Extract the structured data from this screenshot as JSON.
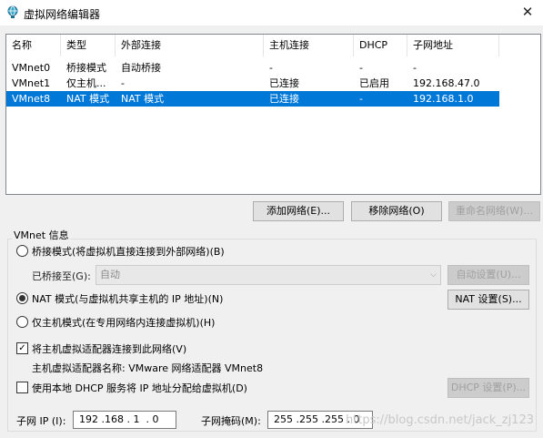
{
  "window": {
    "title": "虚拟网络编辑器",
    "close_label": "✕"
  },
  "table": {
    "headers": [
      "名称",
      "类型",
      "外部连接",
      "主机连接",
      "DHCP",
      "子网地址"
    ],
    "rows": [
      {
        "name": "VMnet0",
        "type": "桥接模式",
        "external": "自动桥接",
        "host": "-",
        "dhcp": "-",
        "subnet": "-"
      },
      {
        "name": "VMnet1",
        "type": "仅主机...",
        "external": "-",
        "host": "已连接",
        "dhcp": "已启用",
        "subnet": "192.168.47.0"
      },
      {
        "name": "VMnet8",
        "type": "NAT 模式",
        "external": "NAT 模式",
        "host": "已连接",
        "dhcp": "-",
        "subnet": "192.168.1.0"
      }
    ],
    "selected_row": 2
  },
  "actions": {
    "add_network": "添加网络(E)...",
    "remove_network": "移除网络(O)",
    "rename_network": "重命名网络(W)..."
  },
  "vmnet_info": {
    "group_label": "VMnet 信息",
    "bridged_option": "桥接模式(将虚拟机直接连接到外部网络)(B)",
    "bridged_to_label": "已桥接至(G):",
    "bridged_to_value": "自动",
    "auto_settings": "自动设置(U)...",
    "nat_option": "NAT 模式(与虚拟机共享主机的 IP 地址)(N)",
    "nat_settings": "NAT 设置(S)...",
    "hostonly_option": "仅主机模式(在专用网络内连接虚拟机)(H)",
    "connect_adapter": "将主机虚拟适配器连接到此网络(V)",
    "adapter_name": "主机虚拟适配器名称: VMware 网络适配器 VMnet8",
    "use_dhcp": "使用本地 DHCP 服务将 IP 地址分配给虚拟机(D)",
    "dhcp_settings": "DHCP 设置(P)...",
    "subnet_ip_label": "子网 IP (I):",
    "subnet_ip_value": "192 .168 . 1  . 0",
    "subnet_mask_label": "子网掩码(M):",
    "subnet_mask_value": "255 .255 .255 . 0",
    "selected_mode": "nat",
    "connect_adapter_checked": true,
    "use_dhcp_checked": false
  },
  "watermark": "https://blog.csdn.net/jack_zj123"
}
